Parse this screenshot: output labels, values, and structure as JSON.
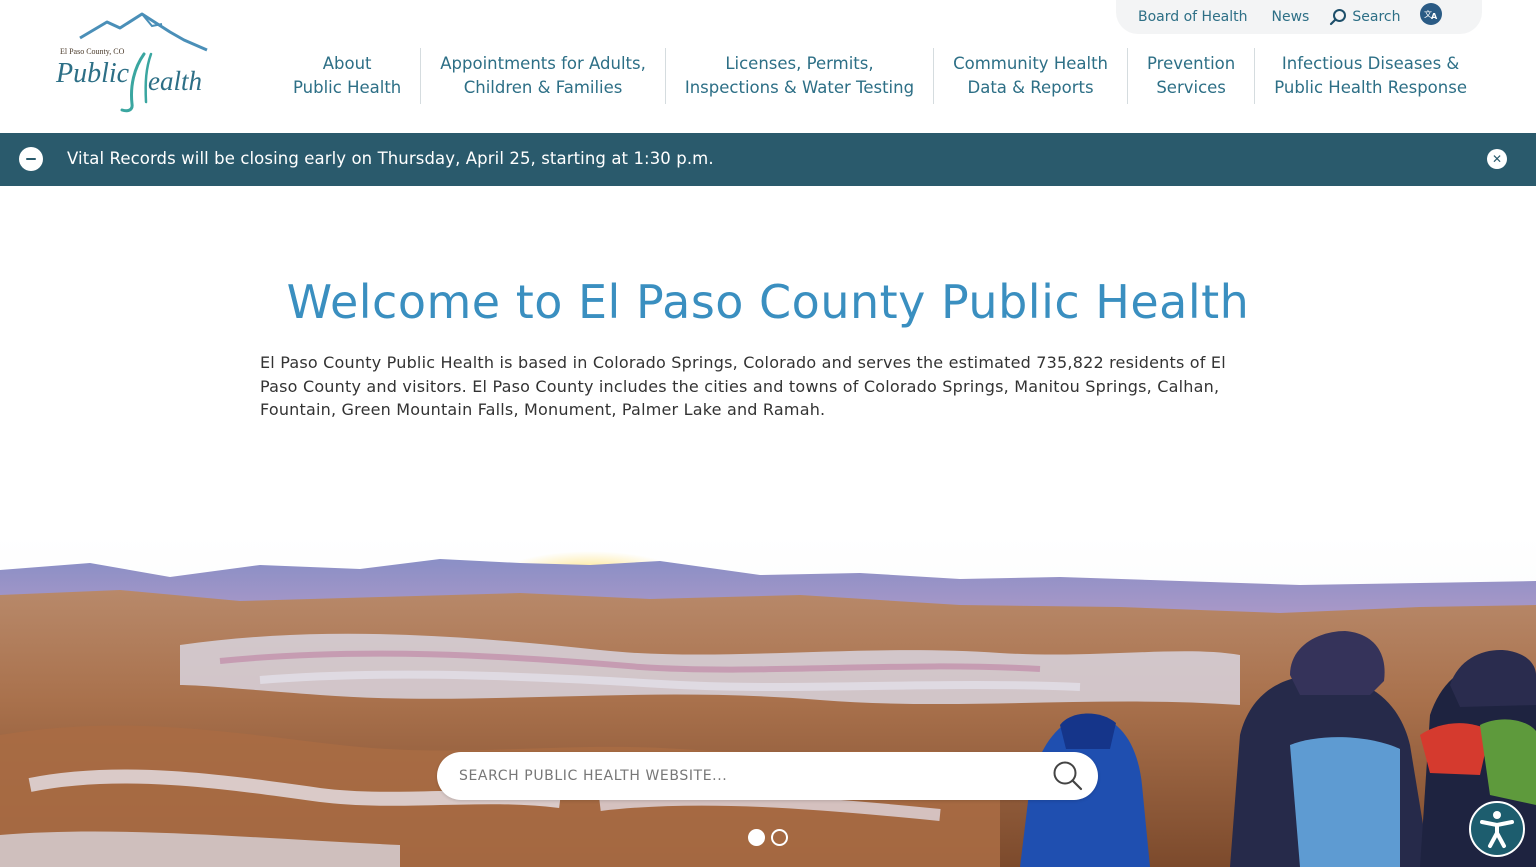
{
  "logo": {
    "county_line": "El Paso County, CO",
    "wordmark": "Public Health"
  },
  "utility": {
    "board": "Board of Health",
    "news": "News",
    "search": "Search"
  },
  "nav": [
    {
      "line1": "About",
      "line2": "Public Health"
    },
    {
      "line1": "Appointments for Adults,",
      "line2": "Children & Families"
    },
    {
      "line1": "Licenses, Permits,",
      "line2": "Inspections & Water Testing"
    },
    {
      "line1": "Community Health",
      "line2": "Data & Reports"
    },
    {
      "line1": "Prevention",
      "line2": "Services"
    },
    {
      "line1": "Infectious Diseases &",
      "line2": "Public Health Response"
    }
  ],
  "alert": {
    "text": "Vital Records will be closing early on Thursday, April 25, starting at 1:30 p.m."
  },
  "welcome": {
    "title": "Welcome to El Paso County Public Health",
    "body": "El Paso County Public Health is based in Colorado Springs, Colorado and serves the estimated 735,822 residents of El Paso County and visitors. El Paso County includes the cities and towns of Colorado Springs, Manitou Springs, Calhan, Fountain, Green Mountain Falls, Monument, Palmer Lake and Ramah."
  },
  "hero": {
    "search_placeholder": "SEARCH PUBLIC HEALTH WEBSITE...",
    "slides_total": 2,
    "slide_active": 1
  },
  "colors": {
    "brand_teal": "#2d6f86",
    "alert_bg": "#2a5a6c",
    "title_blue": "#3a8fc0"
  }
}
